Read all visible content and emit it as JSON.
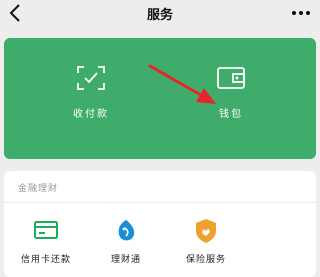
{
  "header": {
    "title": "服务",
    "back_icon": "chevron-left-icon",
    "more_icon": "more-dots-icon"
  },
  "payment_card": {
    "background_color": "#3fac6b",
    "items": [
      {
        "label": "收付款",
        "icon": "scan-pay-icon"
      },
      {
        "label": "钱包",
        "icon": "wallet-icon"
      }
    ]
  },
  "finance_section": {
    "title": "金融理财",
    "items": [
      {
        "label": "信用卡还款",
        "icon": "credit-card-icon",
        "color": "#1aad5f"
      },
      {
        "label": "理财通",
        "icon": "licaitong-icon",
        "color": "#1a8fd8"
      },
      {
        "label": "保险服务",
        "icon": "insurance-icon",
        "color": "#f0a030"
      }
    ]
  },
  "annotation": {
    "arrow_color": "#e8232a",
    "points_to": "wallet"
  }
}
